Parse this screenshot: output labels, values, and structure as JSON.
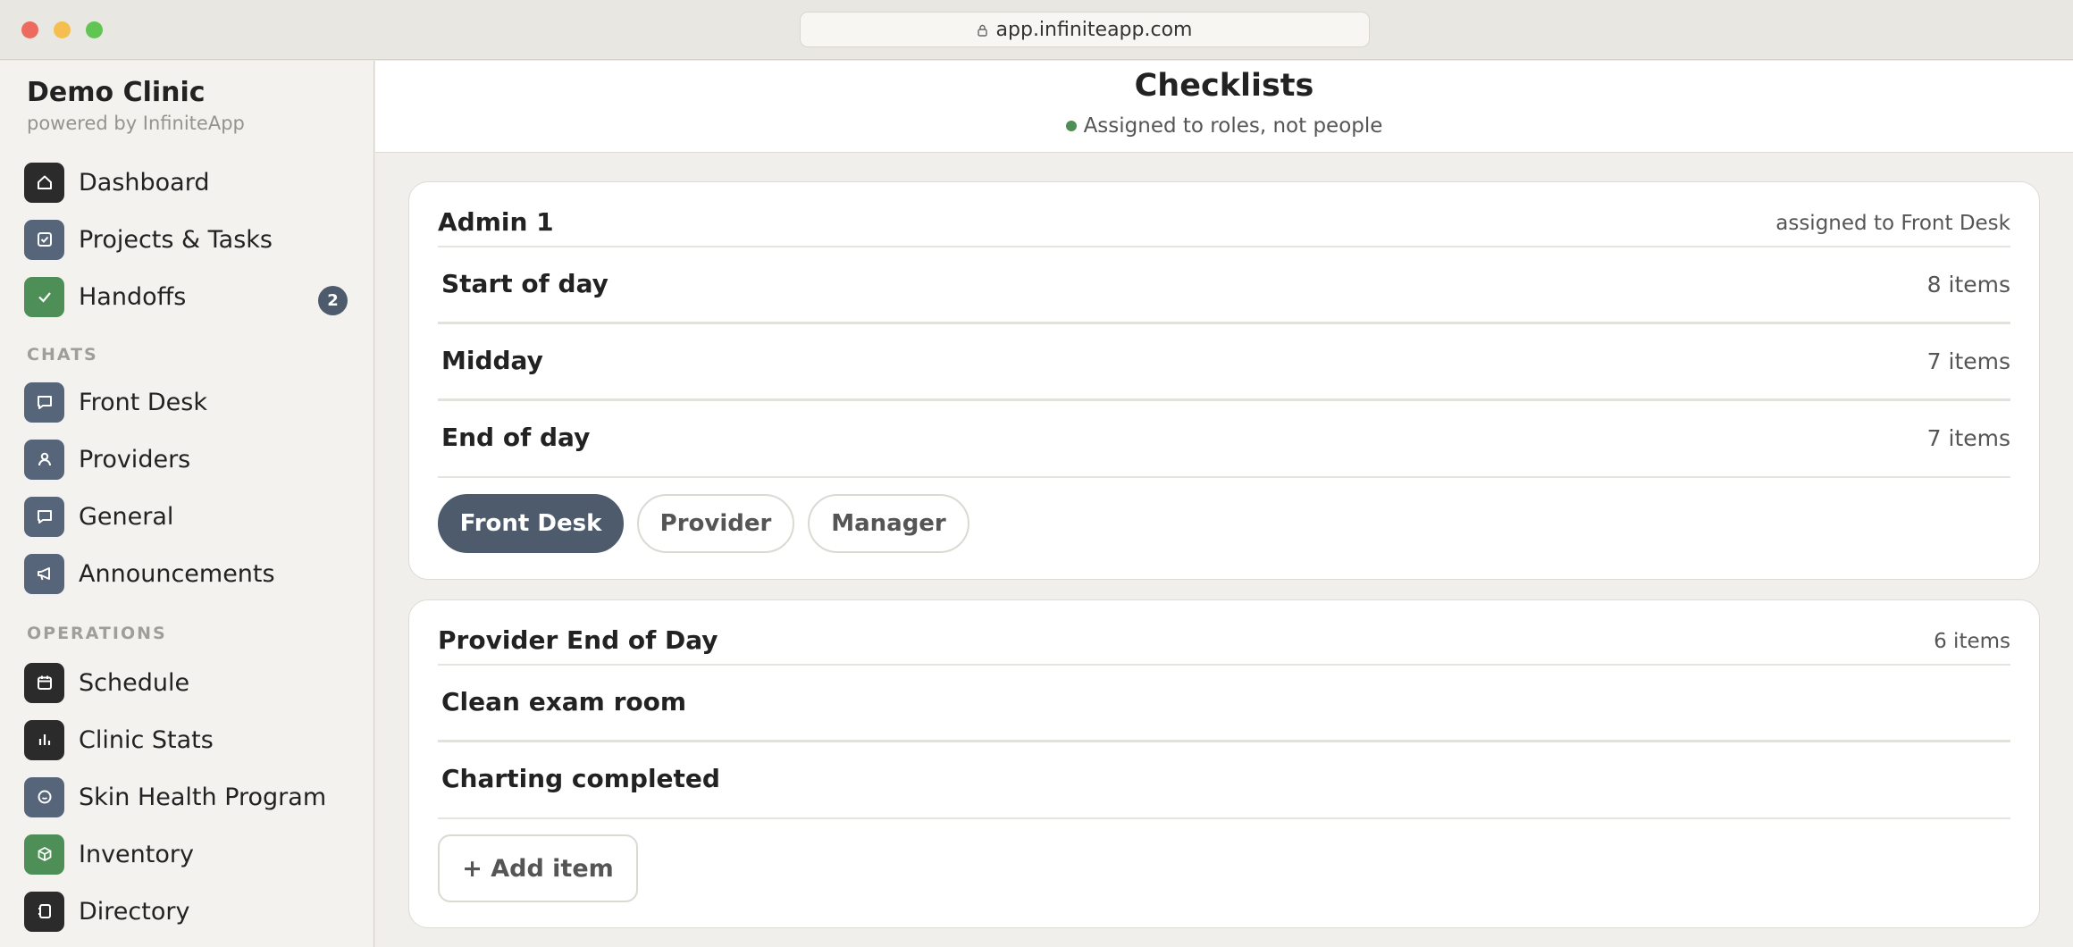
{
  "browser": {
    "url": "app.infiniteapp.com"
  },
  "sidebar": {
    "brand_title": "Demo Clinic",
    "brand_sub": "powered by InfiniteApp",
    "top_items": [
      {
        "label": "Dashboard",
        "icon": "home-icon"
      },
      {
        "label": "Projects & Tasks",
        "icon": "checkbox-icon"
      },
      {
        "label": "Handoffs",
        "icon": "check-icon",
        "badge": "2"
      }
    ],
    "chats_label": "CHATS",
    "chat_items": [
      {
        "label": "Front Desk",
        "icon": "chat-bubble-icon"
      },
      {
        "label": "Providers",
        "icon": "person-icon"
      },
      {
        "label": "General",
        "icon": "chat-bubble-icon"
      },
      {
        "label": "Announcements",
        "icon": "megaphone-icon"
      }
    ],
    "operations_label": "OPERATIONS",
    "operation_items": [
      {
        "label": "Schedule",
        "icon": "calendar-icon"
      },
      {
        "label": "Clinic Stats",
        "icon": "bar-chart-icon"
      },
      {
        "label": "Skin Health Program",
        "icon": "smile-circle-icon"
      },
      {
        "label": "Inventory",
        "icon": "box-icon"
      },
      {
        "label": "Directory",
        "icon": "contacts-book-icon"
      }
    ]
  },
  "main": {
    "title": "Checklists",
    "subtitle": "Assigned to roles, not people",
    "cards": [
      {
        "title": "Admin 1",
        "meta": "assigned to Front Desk",
        "rows": [
          {
            "label": "Start of day",
            "count": "8 items"
          },
          {
            "label": "Midday",
            "count": "7 items"
          },
          {
            "label": "End of day",
            "count": "7 items"
          }
        ],
        "roles": [
          "Front Desk",
          "Provider",
          "Manager"
        ],
        "active_role": "Front Desk"
      },
      {
        "title": "Provider End of Day",
        "meta": "6 items",
        "rows": [
          {
            "label": "Clean exam room"
          },
          {
            "label": "Charting completed"
          }
        ],
        "add_label": "+ Add item"
      }
    ]
  },
  "colors": {
    "accent_slate": "#4d5b6c",
    "accent_green": "#4e8f57",
    "icon_dark": "#2b2b2b"
  }
}
